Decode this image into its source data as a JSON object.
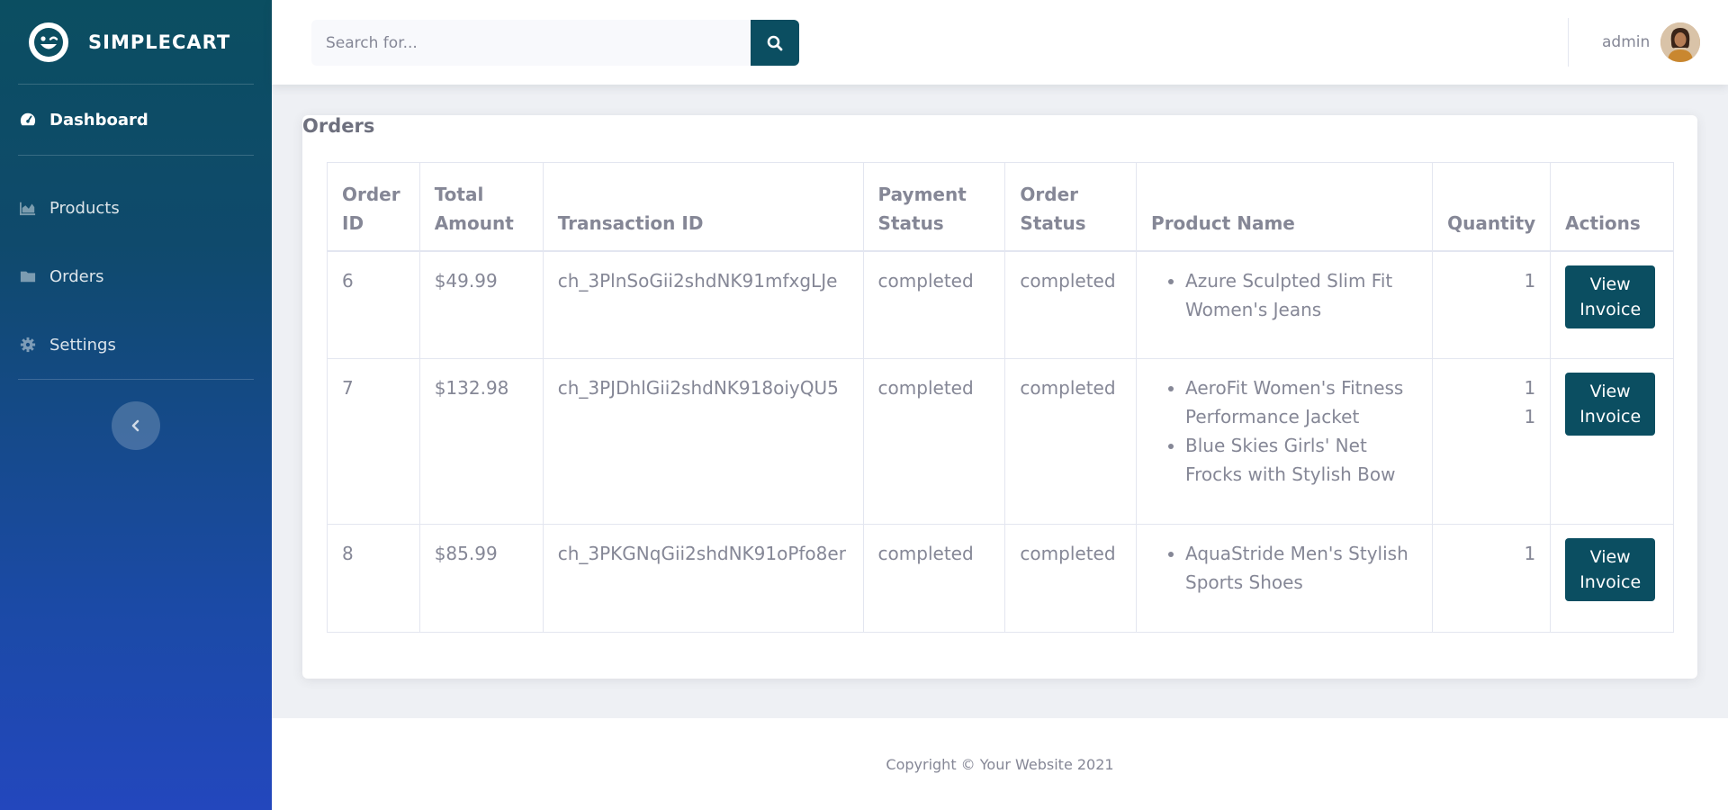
{
  "brand": {
    "name": "SIMPLECART"
  },
  "sidebar": {
    "items": [
      {
        "label": "Dashboard",
        "icon": "tachometer-icon",
        "active": true
      },
      {
        "label": "Products",
        "icon": "chart-area-icon",
        "active": false
      },
      {
        "label": "Orders",
        "icon": "folder-icon",
        "active": false
      },
      {
        "label": "Settings",
        "icon": "gear-icon",
        "active": false
      }
    ]
  },
  "search": {
    "placeholder": "Search for..."
  },
  "user": {
    "name": "admin"
  },
  "card": {
    "title": "Orders"
  },
  "table": {
    "headers": [
      "Order ID",
      "Total Amount",
      "Transaction ID",
      "Payment Status",
      "Order Status",
      "Product Name",
      "Quantity",
      "Actions"
    ],
    "rows": [
      {
        "order_id": "6",
        "total": "$49.99",
        "transaction_id": "ch_3PlnSoGii2shdNK91mfxgLJe",
        "payment_status": "completed",
        "order_status": "completed",
        "products": [
          "Azure Sculpted Slim Fit Women's Jeans"
        ],
        "quantities": [
          "1"
        ],
        "action_label": "View Invoice"
      },
      {
        "order_id": "7",
        "total": "$132.98",
        "transaction_id": "ch_3PJDhlGii2shdNK918oiyQU5",
        "payment_status": "completed",
        "order_status": "completed",
        "products": [
          "AeroFit Women's Fitness Performance Jacket",
          "Blue Skies Girls' Net Frocks with Stylish Bow"
        ],
        "quantities": [
          "1",
          "1"
        ],
        "action_label": "View Invoice"
      },
      {
        "order_id": "8",
        "total": "$85.99",
        "transaction_id": "ch_3PKGNqGii2shdNK91oPfo8er",
        "payment_status": "completed",
        "order_status": "completed",
        "products": [
          "AquaStride Men's Stylish Sports Shoes"
        ],
        "quantities": [
          "1"
        ],
        "action_label": "View Invoice"
      }
    ]
  },
  "footer": {
    "text": "Copyright © Your Website 2021"
  },
  "colors": {
    "primary": "#0b4e61",
    "sidebar_bottom": "#2347bd",
    "text": "#858796"
  }
}
